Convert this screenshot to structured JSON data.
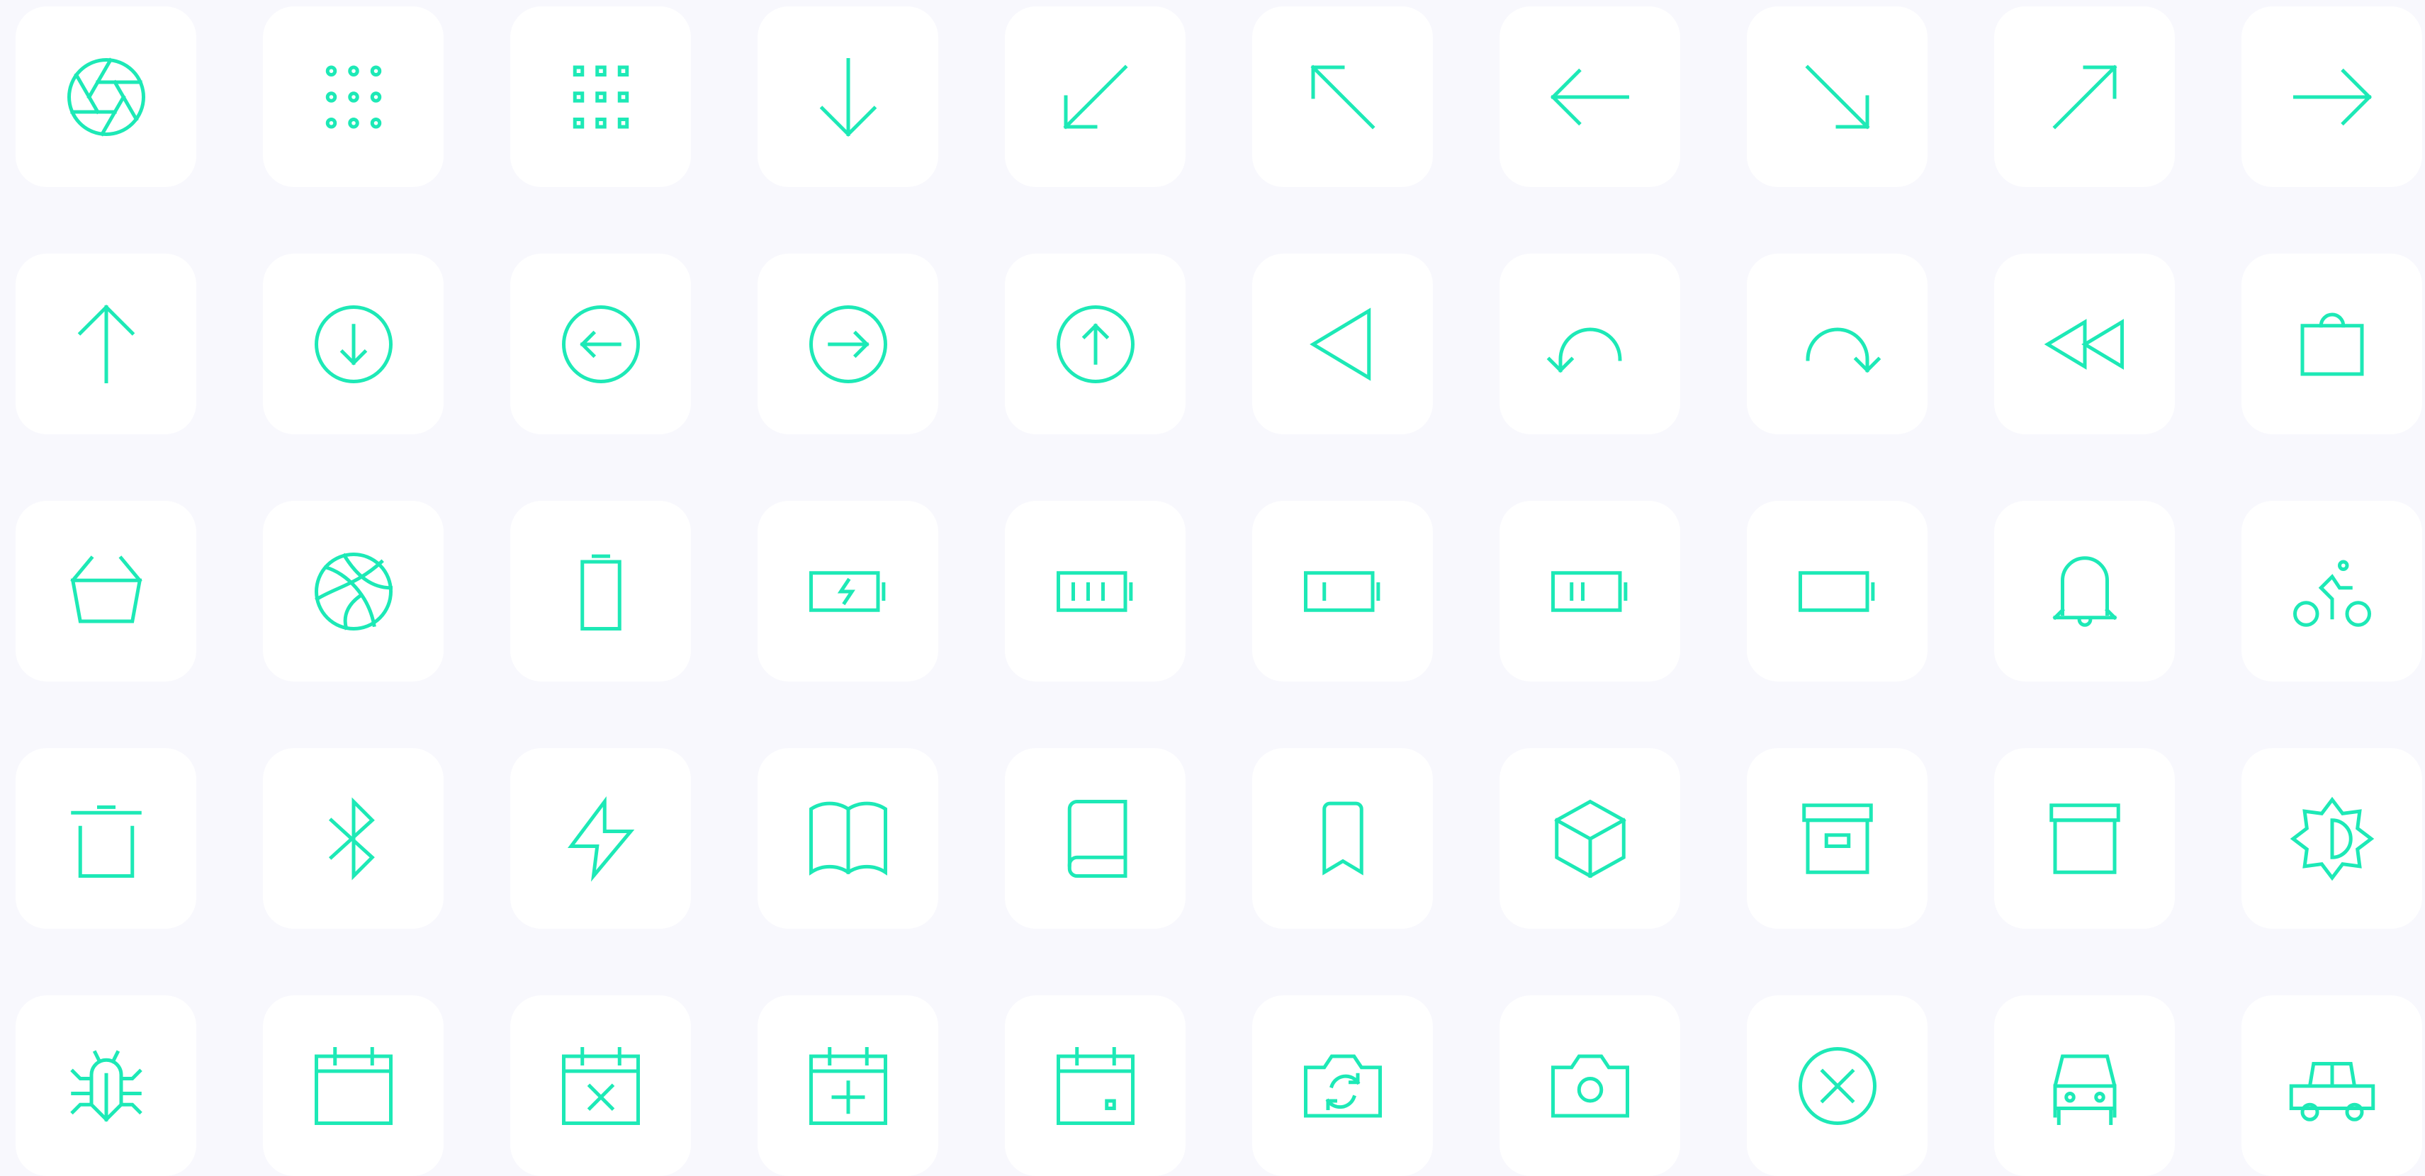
{
  "accent_color": "#1de9b6",
  "tile_color": "#ffffff",
  "background_color": "#f8f8fd",
  "icons": [
    "aperture-icon",
    "dots-grid-icon",
    "squares-grid-icon",
    "arrow-down-icon",
    "arrow-down-left-icon",
    "arrow-up-left-icon",
    "arrow-left-icon",
    "arrow-down-right-icon",
    "arrow-up-right-icon",
    "arrow-right-icon",
    "arrow-up-icon",
    "arrow-down-circle-icon",
    "arrow-left-circle-icon",
    "arrow-right-circle-icon",
    "arrow-up-circle-icon",
    "triangle-left-icon",
    "undo-icon",
    "redo-icon",
    "rewind-icon",
    "shopping-bag-icon",
    "basket-icon",
    "basketball-icon",
    "battery-empty-vertical-icon",
    "battery-charging-icon",
    "battery-full-icon",
    "battery-low-icon",
    "battery-half-icon",
    "battery-empty-icon",
    "bell-icon",
    "bicycle-icon",
    "trash-icon",
    "bluetooth-icon",
    "lightning-icon",
    "book-open-icon",
    "book-icon",
    "bookmark-icon",
    "box-icon",
    "archive-box-icon",
    "archive-icon",
    "brightness-icon",
    "bug-icon",
    "calendar-icon",
    "calendar-remove-icon",
    "calendar-add-icon",
    "calendar-event-icon",
    "camera-rotate-icon",
    "camera-icon",
    "close-circle-icon",
    "car-icon",
    "taxi-icon"
  ]
}
